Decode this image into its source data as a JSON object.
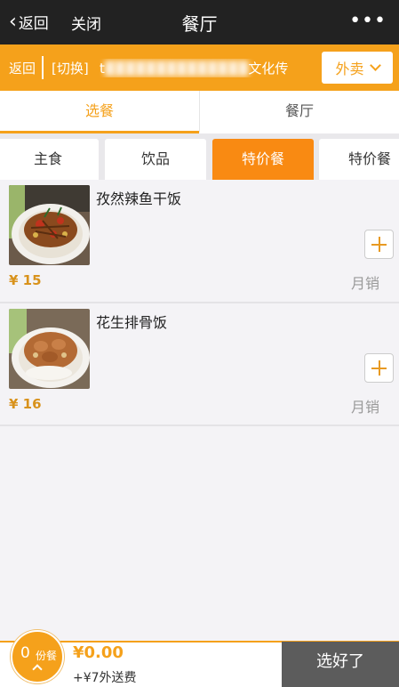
{
  "navbar": {
    "back_label": "返回",
    "close_label": "关闭",
    "title": "餐厅",
    "more_icon": "more-dots-icon"
  },
  "infobar": {
    "back_label": "返回",
    "switch_label": "[切换]",
    "store_name_visible_prefix": "t",
    "store_name_visible_suffix": "文化传",
    "mode_select_value": "外卖",
    "accent_color": "#f5a11b"
  },
  "main_tabs": [
    {
      "label": "选餐",
      "active": true
    },
    {
      "label": "餐厅",
      "active": false
    }
  ],
  "category_tabs": [
    {
      "label": "主食",
      "active": false
    },
    {
      "label": "饮品",
      "active": false
    },
    {
      "label": "特价餐",
      "active": true
    },
    {
      "label": "特价餐",
      "active": false
    }
  ],
  "dishes": [
    {
      "name": "孜然辣鱼干饭",
      "price": "¥ 15",
      "sales_label": "月销",
      "image": "spicy-fish-rice-bowl"
    },
    {
      "name": "花生排骨饭",
      "price": "¥ 16",
      "sales_label": "月销",
      "image": "peanut-pork-rib-rice-bowl"
    }
  ],
  "cart": {
    "count": "0",
    "unit": "份餐",
    "total": "¥0.00",
    "delivery_fee": "+¥7外送费",
    "checkout_label": "选好了"
  }
}
